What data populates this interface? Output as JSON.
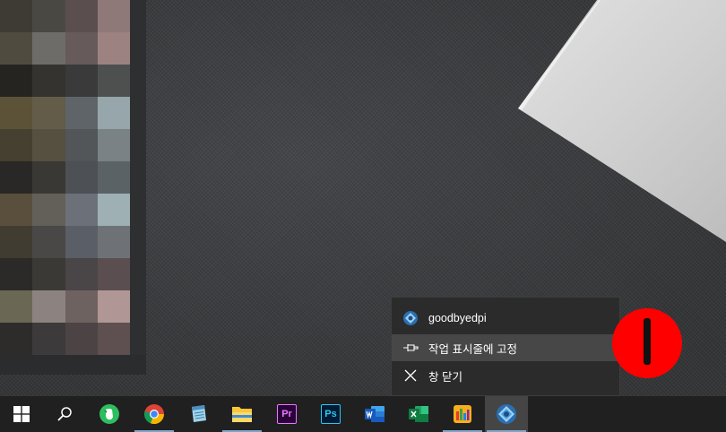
{
  "colors": {
    "taskbar_bg": "#202020",
    "menu_bg": "#2b2b2b",
    "menu_highlight": "#474747",
    "marker_red": "#ff0000",
    "running_indicator": "#7fa6c9"
  },
  "jumplist": {
    "app_title": "goodbyedpi",
    "pin_label": "작업 표시줄에 고정",
    "close_label": "창 닫기"
  },
  "taskbar": {
    "start_icon": "windows-logo-icon",
    "search_icon": "search-icon",
    "apps": [
      {
        "name": "evernote-icon",
        "running": false
      },
      {
        "name": "chrome-icon",
        "running": true
      },
      {
        "name": "notepad-icon",
        "running": false
      },
      {
        "name": "file-explorer-icon",
        "running": true
      },
      {
        "name": "premiere-pro-icon",
        "text": "Pr",
        "running": false
      },
      {
        "name": "photoshop-icon",
        "text": "Ps",
        "running": false
      },
      {
        "name": "word-icon",
        "running": false
      },
      {
        "name": "excel-icon",
        "running": false
      },
      {
        "name": "app-icon",
        "running": true
      },
      {
        "name": "goodbyedpi-icon",
        "running": true,
        "active": true
      }
    ]
  }
}
